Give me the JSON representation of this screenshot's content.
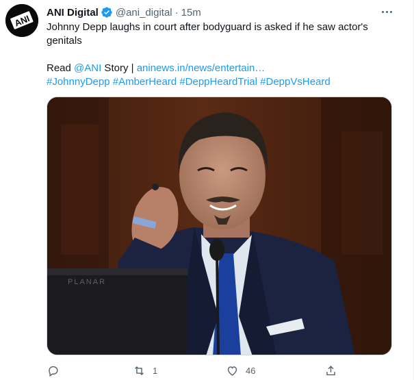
{
  "tweet": {
    "author_name": "ANI Digital",
    "handle": "@ani_digital",
    "separator": "·",
    "time": "15m",
    "avatar_text": "ANI",
    "text_line1": "Johnny Depp laughs in court after bodyguard is asked if he saw actor's genitals",
    "read_prefix": "Read ",
    "mention": "@ANI",
    "story_label": " Story | ",
    "url": "aninews.in/news/entertain…",
    "hashtags": [
      "#JohnnyDepp",
      "#AmberHeard",
      "#DeppHeardTrial",
      "#DeppVsHeard"
    ],
    "monitor_label": "PLANAR"
  },
  "actions": {
    "reply_count": "",
    "retweet_count": "1",
    "like_count": "46",
    "share_count": ""
  },
  "colors": {
    "link": "#1d9bf0",
    "muted": "#536471",
    "verified": "#1d9bf0"
  }
}
